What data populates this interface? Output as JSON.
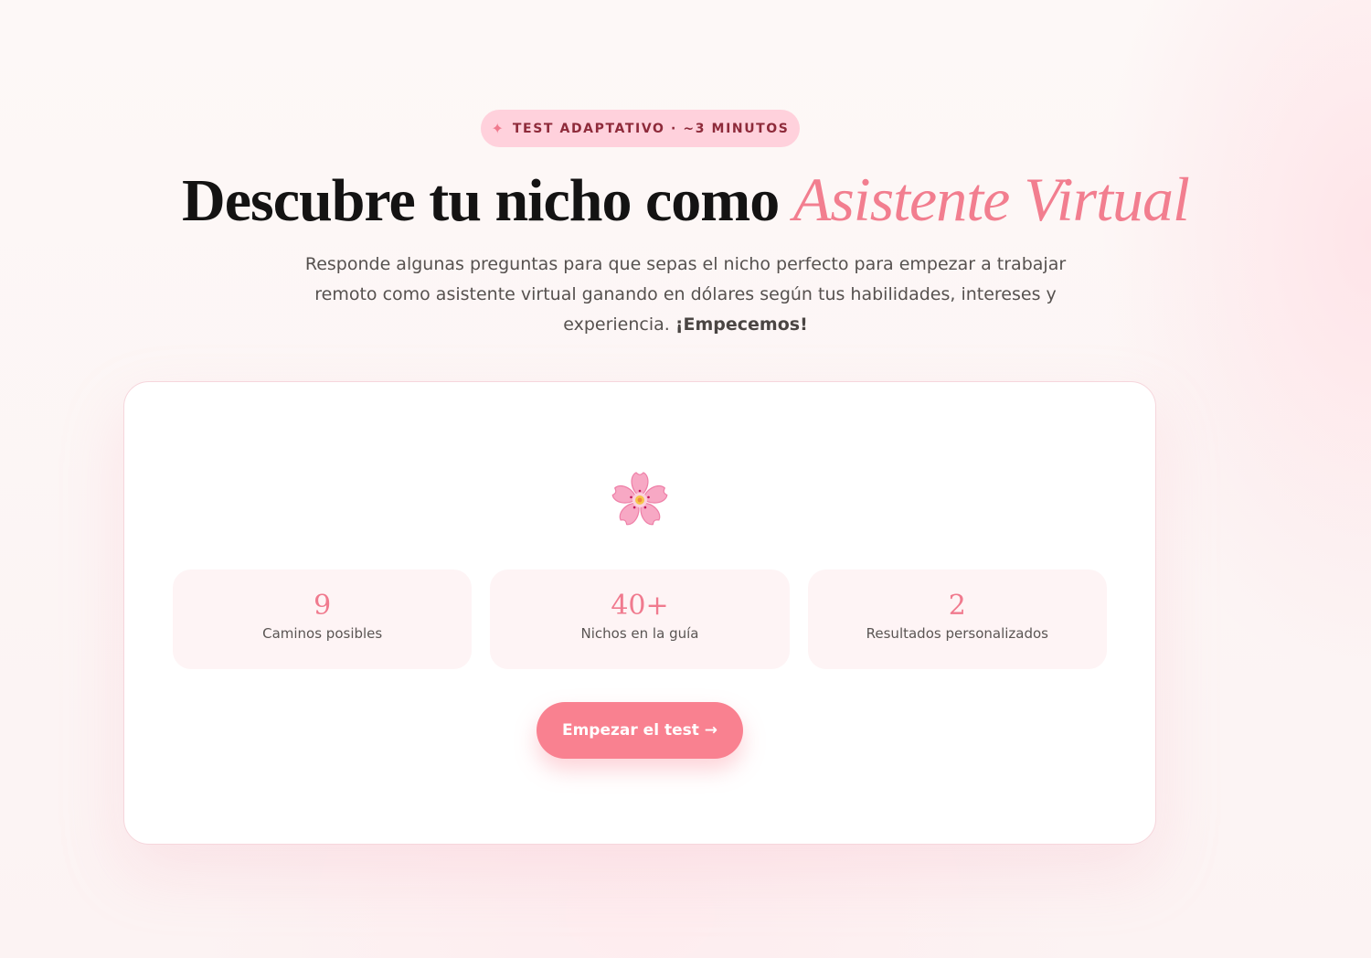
{
  "badge": {
    "icon": "sparkle-icon",
    "text": "TEST ADAPTATIVO · ~3 MINUTOS"
  },
  "hero": {
    "title_plain": "Descubre tu nicho como ",
    "title_accent": "Asistente Virtual",
    "subtitle": "Responde algunas preguntas para que sepas el nicho perfecto para empezar a trabajar remoto como asistente virtual ganando en dólares según tus habilidades, intereses y experiencia. ",
    "subtitle_bold": "¡Empecemos!"
  },
  "card": {
    "icon": "cherry-blossom-icon",
    "stats": [
      {
        "value": "9",
        "label": "Caminos posibles"
      },
      {
        "value": "40+",
        "label": "Nichos en la guía"
      },
      {
        "value": "2",
        "label": "Resultados personalizados"
      }
    ],
    "cta_label": "Empezar el test →"
  },
  "colors": {
    "accent": "#f27e8f",
    "button": "#f98190",
    "badge_bg": "#ffd1dc",
    "badge_text": "#8e2a3a",
    "stat_bg": "#fef4f5"
  }
}
